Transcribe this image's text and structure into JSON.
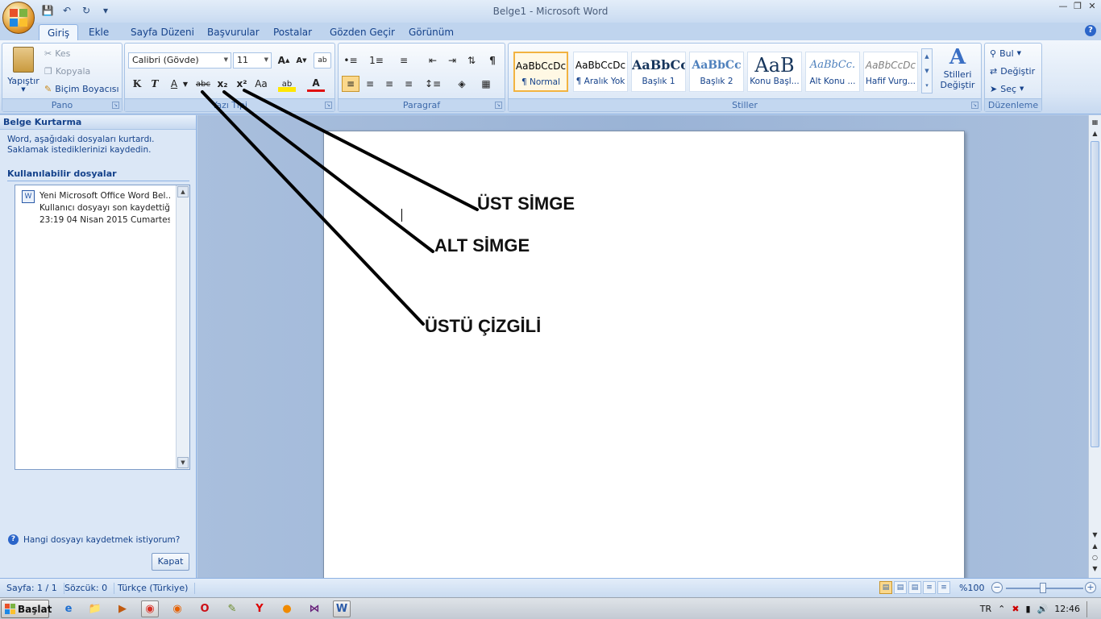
{
  "window": {
    "title": "Belge1 - Microsoft Word"
  },
  "qat": {
    "save_icon": "save-icon",
    "undo_icon": "undo-icon",
    "redo_icon": "redo-icon",
    "customize_icon": "customize-icon"
  },
  "tabs": [
    {
      "label": "Giriş",
      "active": true
    },
    {
      "label": "Ekle"
    },
    {
      "label": "Sayfa Düzeni"
    },
    {
      "label": "Başvurular"
    },
    {
      "label": "Postalar"
    },
    {
      "label": "Gözden Geçir"
    },
    {
      "label": "Görünüm"
    }
  ],
  "ribbon": {
    "pano": {
      "label": "Pano",
      "paste": "Yapıştır",
      "cut": "Kes",
      "copy": "Kopyala",
      "format_painter": "Biçim Boyacısı"
    },
    "font": {
      "label": "Yazı Tipi",
      "family": "Calibri (Gövde)",
      "size": "11",
      "bold": "K",
      "italic": "T",
      "underline": "A",
      "strike": "abc",
      "subscript": "x₂",
      "superscript": "x²",
      "change_case": "Aa",
      "highlight": "ab",
      "font_color": "A"
    },
    "paragraph": {
      "label": "Paragraf",
      "pilcrow": "¶"
    },
    "styles": {
      "label": "Stiller",
      "tiles": [
        {
          "sample": "AaBbCcDc",
          "name": "¶ Normal",
          "selected": true
        },
        {
          "sample": "AaBbCcDc",
          "name": "¶ Aralık Yok"
        },
        {
          "sample": "AaBbCc",
          "name": "Başlık 1"
        },
        {
          "sample": "AaBbCc",
          "name": "Başlık 2"
        },
        {
          "sample": "AaB",
          "name": "Konu Başl..."
        },
        {
          "sample": "AaBbCc.",
          "name": "Alt Konu ..."
        },
        {
          "sample": "AaBbCcDc",
          "name": "Hafif Vurg..."
        }
      ],
      "change_styles_line1": "Stilleri",
      "change_styles_line2": "Değiştir"
    },
    "editing": {
      "label": "Düzenleme",
      "find": "Bul",
      "replace": "Değiştir",
      "select": "Seç"
    }
  },
  "recovery": {
    "title": "Belge Kurtarma",
    "description": "Word, aşağıdaki dosyaları kurtardı.  Saklamak istediklerinizi kaydedin.",
    "files_header": "Kullanılabilir dosyalar",
    "file": {
      "line1": "Yeni Microsoft Office Word Bel...",
      "line2": "Kullanıcı dosyayı son kaydettiğ...",
      "line3": "23:19 04 Nisan 2015 Cumartesi"
    },
    "question": "Hangi dosyayı kaydetmek istiyorum?",
    "close": "Kapat"
  },
  "document": {
    "annotations": {
      "superscript": "ÜST SİMGE",
      "subscript": "ALT SİMGE",
      "strikethrough": "ÜSTÜ ÇİZGİLİ"
    }
  },
  "status": {
    "page": "Sayfa: 1 / 1",
    "words": "Sözcük: 0",
    "language": "Türkçe (Türkiye)",
    "zoom": "%100",
    "zoom_level_percent": 100
  },
  "taskbar": {
    "start": "Başlat",
    "apps": [
      "ie-icon",
      "explorer-icon",
      "media-player-icon",
      "chrome-icon",
      "firefox-icon",
      "opera-icon",
      "notepad-icon",
      "yandex-icon",
      "orange-app-icon",
      "visual-studio-icon",
      "word-icon"
    ],
    "lang": "TR",
    "time": "12:46"
  }
}
